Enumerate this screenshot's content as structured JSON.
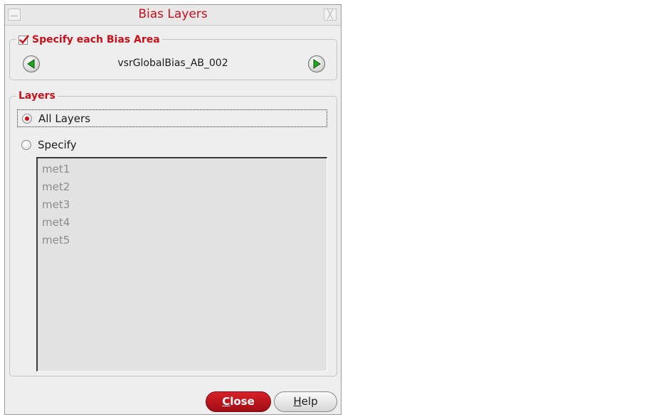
{
  "window": {
    "title": "Bias Layers",
    "close_glyph": "╳",
    "accent_color": "#c8101a"
  },
  "bias_area": {
    "checkbox_label": "Specify each Bias Area",
    "checked": true,
    "current_name": "vsrGlobalBias_AB_002",
    "prev_icon": "green-left-arrow",
    "next_icon": "green-right-arrow"
  },
  "layers": {
    "group_label": "Layers",
    "options": [
      {
        "label": "All Layers",
        "selected": true
      },
      {
        "label": "Specify",
        "selected": false
      }
    ],
    "list": [
      "met1",
      "met2",
      "met3",
      "met4",
      "met5"
    ]
  },
  "buttons": {
    "close": {
      "mnemonic": "C",
      "rest": "lose"
    },
    "help": {
      "mnemonic": "H",
      "rest": "elp"
    }
  }
}
